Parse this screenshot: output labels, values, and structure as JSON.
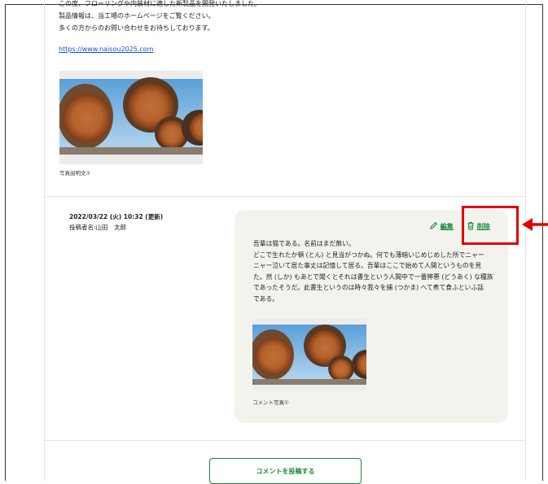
{
  "post": {
    "lines": [
      "この度、フローリングや内装材に適した新製品を開発いたしました。",
      "製品情報は、当工場のホームページをご覧ください。",
      "多くの方からのお問い合わせをお待ちしております。"
    ],
    "link": "https://www.naisou2025.com",
    "photo_caption": "写真説明文①"
  },
  "comment": {
    "date": "2022/03/22 (火) 10:32 (更新)",
    "author": "投稿者名:山田　太郎",
    "edit_label": "編集",
    "delete_label": "削除",
    "text_lines": [
      "吾輩は猫である。名前はまだ無い。",
      "どこで生れたか頓 (とん) と見当がつかぬ。何でも薄暗いじめじめした所でニャー",
      "ニャー泣いて居た事丈は記憶して居る。吾輩はここで始めて人間というものを見",
      "た。然 (しか) もあとで聞くとそれは書生という人間中で一番獰悪 (どうあく) な種族",
      "であったそうだ。此書生というのは時々我々を捕 (つかま) へて煮て食ふといふ話",
      "である。"
    ],
    "photo_caption": "コメント写真①"
  },
  "footer": {
    "post_comment_label": "コメントを投稿する"
  },
  "colors": {
    "accent_green": "#1a8a3c",
    "highlight_red": "#e00000",
    "bubble_bg": "#f3f3ee"
  }
}
